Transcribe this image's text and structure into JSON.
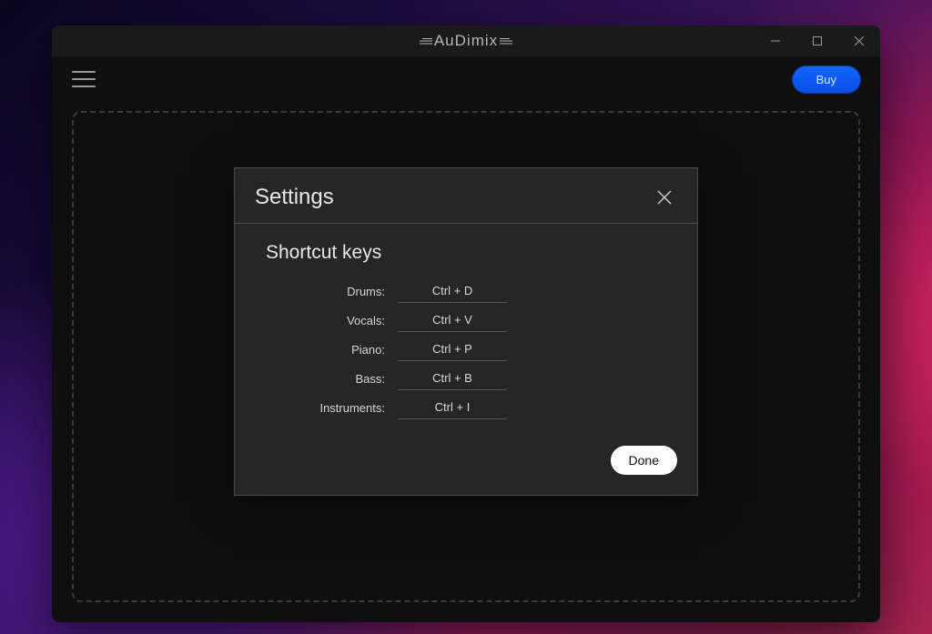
{
  "app": {
    "title": "AuDimix"
  },
  "toolbar": {
    "buy_label": "Buy"
  },
  "settings": {
    "title": "Settings",
    "section_title": "Shortcut keys",
    "done_label": "Done",
    "shortcuts": [
      {
        "label": "Drums:",
        "value": "Ctrl + D"
      },
      {
        "label": "Vocals:",
        "value": "Ctrl + V"
      },
      {
        "label": "Piano:",
        "value": "Ctrl + P"
      },
      {
        "label": "Bass:",
        "value": "Ctrl + B"
      },
      {
        "label": "Instruments:",
        "value": "Ctrl + I"
      }
    ]
  }
}
